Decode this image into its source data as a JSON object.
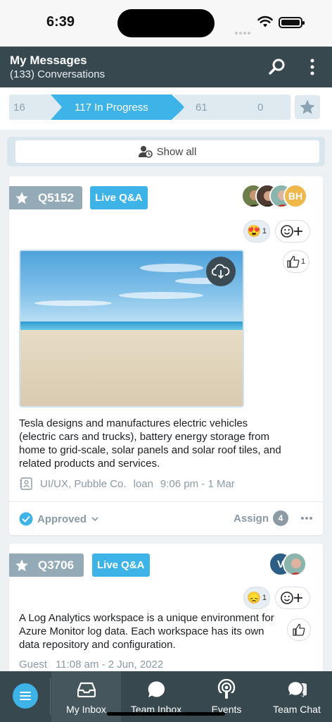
{
  "status": {
    "time": "6:39"
  },
  "header": {
    "title": "My Messages",
    "subtitle": "(133) Conversations"
  },
  "pipeline": {
    "steps": [
      {
        "label": "16",
        "active": false
      },
      {
        "label": "117 In Progress",
        "active": true
      },
      {
        "label": "61",
        "active": false
      },
      {
        "label": "0",
        "active": false
      }
    ]
  },
  "show_all": {
    "label": "Show all"
  },
  "cards": [
    {
      "id": "Q5152",
      "tag": "Live Q&A",
      "avatars": [
        {
          "initials": "BH",
          "color": "#f0b84a"
        }
      ],
      "reactions": [
        {
          "emoji": "😍",
          "count": "1"
        }
      ],
      "thumbs_count": "1",
      "text": "Tesla designs and manufactures electric vehicles (electric cars and trucks), battery energy storage from home to grid-scale, solar panels and solar roof tiles, and related products and services.",
      "meta": {
        "team": "UI/UX, Pubble Co.",
        "user": "loan",
        "time": "9:06 pm - 1 Mar"
      },
      "status": "Approved",
      "assign_label": "Assign",
      "assign_count": "4"
    },
    {
      "id": "Q3706",
      "tag": "Live Q&A",
      "avatars": [
        {
          "initials": "V",
          "color": "#2d5f86"
        }
      ],
      "reactions": [
        {
          "emoji": "😞",
          "count": "1"
        }
      ],
      "text": "A Log Analytics workspace is a unique environment for Azure Monitor log data. Each workspace has its own data repository and configuration.",
      "meta": {
        "user": "Guest",
        "time": "11:08 am - 2 Jun, 2022"
      }
    }
  ],
  "nav": {
    "items": [
      {
        "label": "My Inbox",
        "icon": "inbox-icon"
      },
      {
        "label": "Team Inbox",
        "icon": "chat-bubble-icon"
      },
      {
        "label": "Events",
        "icon": "podcast-icon"
      },
      {
        "label": "Team Chat",
        "icon": "chat-bubbles-icon"
      }
    ]
  },
  "colors": {
    "header": "#37484f",
    "accent": "#3eb3e8",
    "badge": "#94aab7"
  }
}
